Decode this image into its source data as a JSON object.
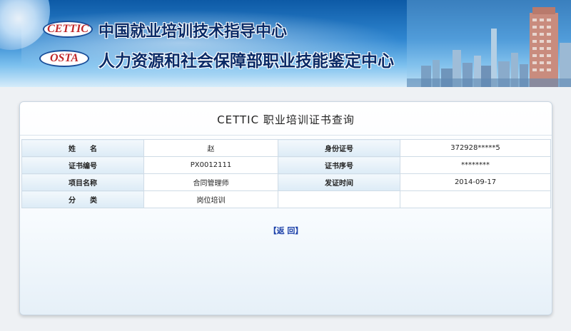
{
  "header": {
    "logo1": "CETTIC",
    "title1": "中国就业培训技术指导中心",
    "logo2": "OSTA",
    "title2": "人力资源和社会保障部职业技能鉴定中心"
  },
  "panel": {
    "title": "CETTIC 职业培训证书查询"
  },
  "table": {
    "rows": [
      {
        "label1": "姓　　名",
        "value1": "赵",
        "label2": "身份证号",
        "value2": "372928*****5"
      },
      {
        "label1": "证书编号",
        "value1": "PX0012111",
        "label2": "证书序号",
        "value2": "********"
      },
      {
        "label1": "项目名称",
        "value1": "合同管理师",
        "label2": "发证时间",
        "value2": "2014-09-17"
      },
      {
        "label1": "分　　类",
        "value1": "岗位培训",
        "label2": "",
        "value2": ""
      }
    ]
  },
  "back_link": "【返 回】"
}
